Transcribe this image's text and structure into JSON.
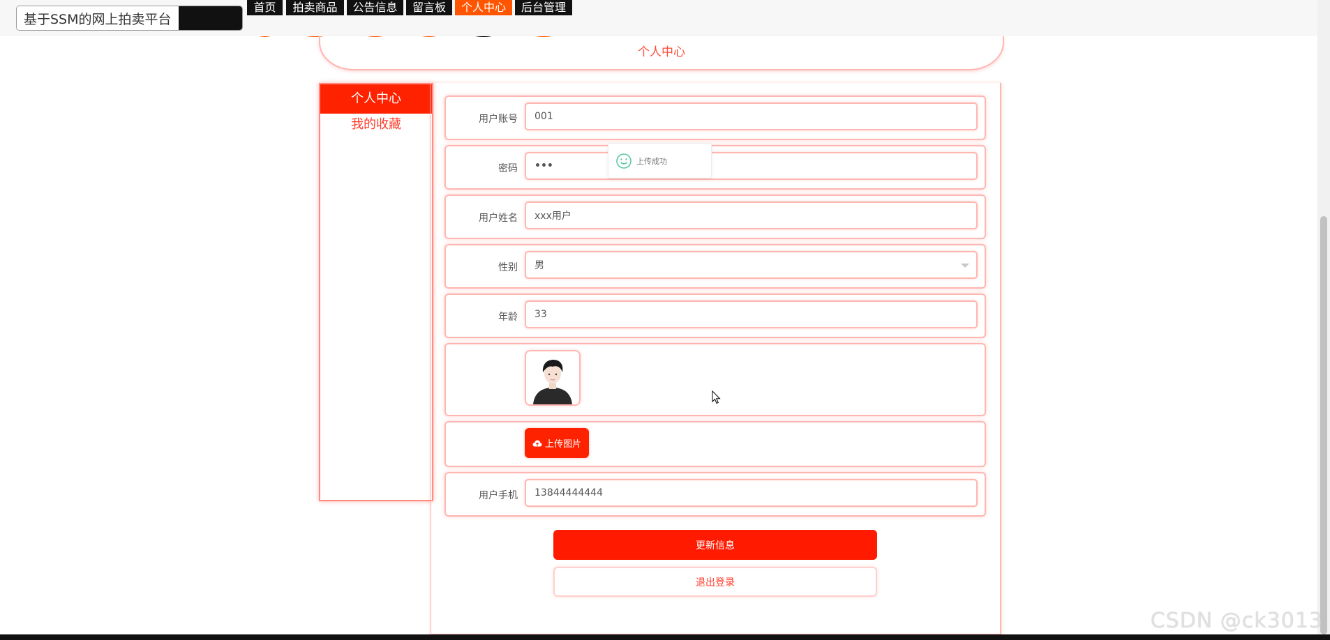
{
  "header": {
    "brand_title": "基于SSM的网上拍卖平台",
    "nav": [
      {
        "label": "首页",
        "active": false
      },
      {
        "label": "拍卖商品",
        "active": false
      },
      {
        "label": "公告信息",
        "active": false
      },
      {
        "label": "留言板",
        "active": false
      },
      {
        "label": "个人中心",
        "active": true
      },
      {
        "label": "后台管理",
        "active": false
      }
    ]
  },
  "page_title": "个人中心",
  "sidebar": {
    "items": [
      {
        "label": "个人中心",
        "active": true
      },
      {
        "label": "我的收藏",
        "active": false
      }
    ]
  },
  "form": {
    "account": {
      "label": "用户账号",
      "value": "001"
    },
    "password": {
      "label": "密码",
      "value": "•••"
    },
    "name": {
      "label": "用户姓名",
      "value": "xxx用户"
    },
    "gender": {
      "label": "性别",
      "value": "男"
    },
    "age": {
      "label": "年龄",
      "value": "33"
    },
    "upload_label": "上传图片",
    "phone": {
      "label": "用户手机",
      "value": "13844444444"
    }
  },
  "buttons": {
    "update": "更新信息",
    "logout": "退出登录"
  },
  "toast": {
    "message": "上传成功",
    "icon": "smile-icon"
  },
  "watermark": "CSDN @ck3013",
  "colors": {
    "accent_red": "#ff2200",
    "nav_orange": "#ff5500",
    "nav_dark": "#111111",
    "border_pink": "#ffb6b0",
    "text_red": "#ff3b2a"
  }
}
